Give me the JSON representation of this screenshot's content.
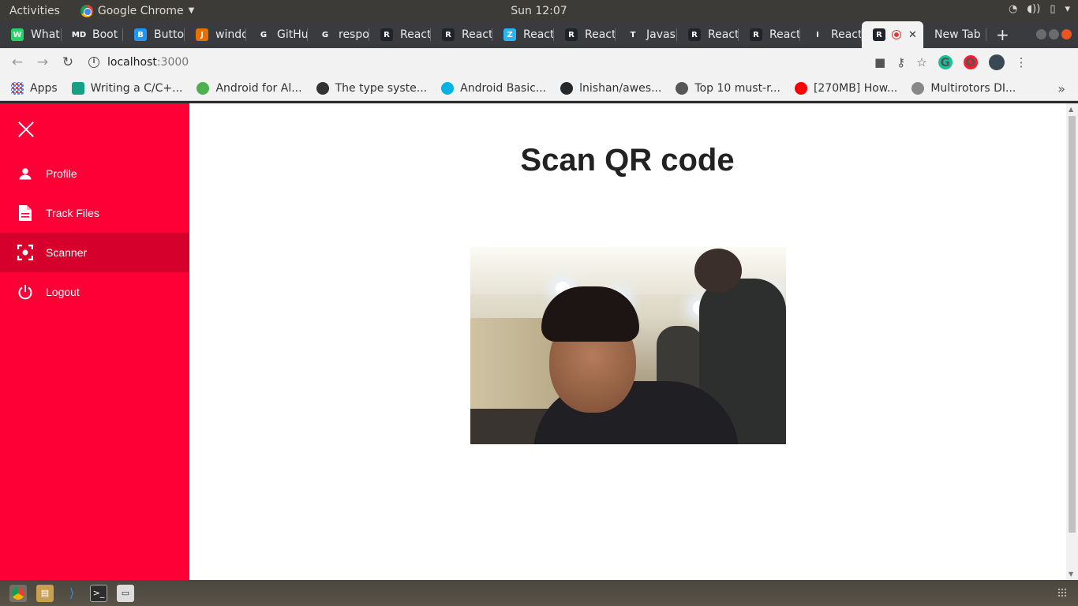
{
  "system_bar": {
    "activities": "Activities",
    "app_name": "Google Chrome",
    "clock": "Sun 12:07"
  },
  "tabs": [
    {
      "label": "What",
      "color": "#25d366",
      "glyph": "W"
    },
    {
      "label": "Boot",
      "color": "#3a3b3e",
      "glyph": "MD"
    },
    {
      "label": "Butto",
      "color": "#2196f3",
      "glyph": "B"
    },
    {
      "label": "windo",
      "color": "#e76f00",
      "glyph": "J"
    },
    {
      "label": "GitHu",
      "color": "#3a3b3e",
      "glyph": "G"
    },
    {
      "label": "respo",
      "color": "#3a3b3e",
      "glyph": "G"
    },
    {
      "label": "React",
      "color": "#20232a",
      "glyph": "R"
    },
    {
      "label": "React",
      "color": "#20232a",
      "glyph": "R"
    },
    {
      "label": "React",
      "color": "#29b6f6",
      "glyph": "Z"
    },
    {
      "label": "React",
      "color": "#20232a",
      "glyph": "R"
    },
    {
      "label": "Javas",
      "color": "#3a3b3e",
      "glyph": "T"
    },
    {
      "label": "React",
      "color": "#20232a",
      "glyph": "R"
    },
    {
      "label": "React",
      "color": "#20232a",
      "glyph": "R"
    },
    {
      "label": "React",
      "color": "#3a3b3e",
      "glyph": "I"
    }
  ],
  "active_tab": {
    "label": "",
    "close": "✕"
  },
  "new_tab": {
    "label": "New Tab"
  },
  "address": {
    "host": "localhost",
    "port": ":3000"
  },
  "bookmarks": [
    {
      "label": "Apps",
      "color": "#4285f4"
    },
    {
      "label": "Writing a C/C+...",
      "color": "#16a085"
    },
    {
      "label": "Android for Al...",
      "color": "#4caf50"
    },
    {
      "label": "The type syste...",
      "color": "#333333"
    },
    {
      "label": "Android Basic...",
      "color": "#02b3e4"
    },
    {
      "label": "lnishan/awes...",
      "color": "#24292e"
    },
    {
      "label": "Top 10 must-r...",
      "color": "#555555"
    },
    {
      "label": "[270MB] How...",
      "color": "#ff0000"
    },
    {
      "label": "Multirotors DI...",
      "color": "#888888"
    }
  ],
  "sidebar": {
    "items": [
      {
        "label": "Profile",
        "icon": "person-icon"
      },
      {
        "label": "Track Files",
        "icon": "file-icon"
      },
      {
        "label": "Scanner",
        "icon": "scanner-icon",
        "active": true
      },
      {
        "label": "Logout",
        "icon": "power-icon"
      }
    ],
    "bg_color": "#ff0036",
    "active_color": "#d6002c"
  },
  "main": {
    "title": "Scan QR code"
  }
}
